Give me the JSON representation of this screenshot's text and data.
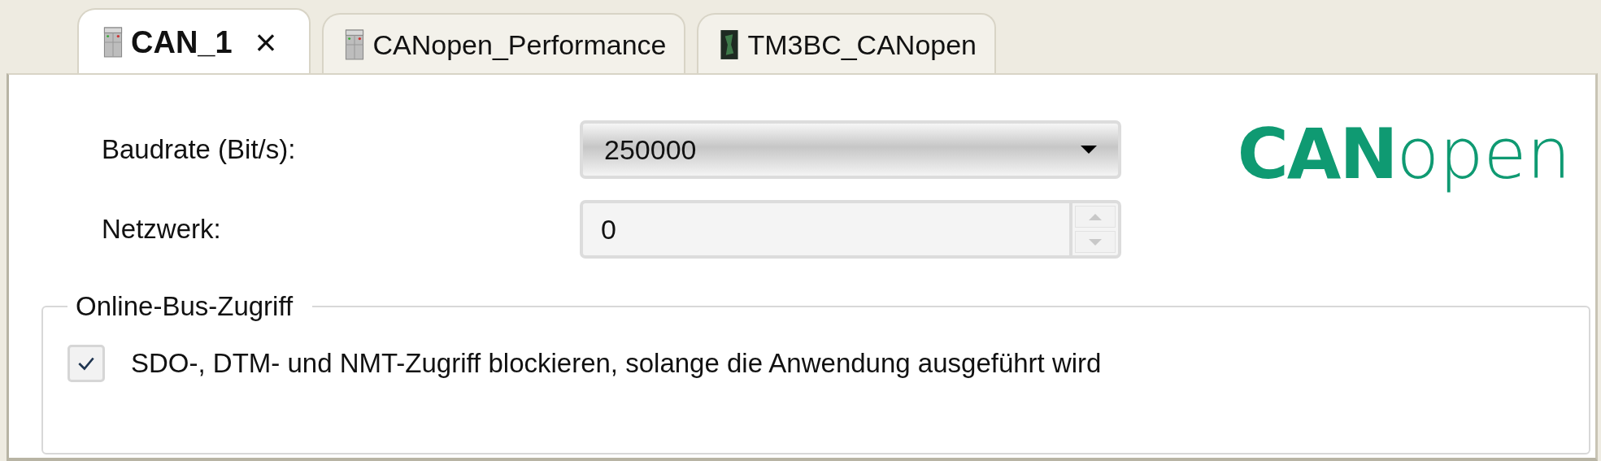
{
  "tabs": [
    {
      "label": "CAN_1",
      "selected": true,
      "kind": "controller",
      "close": "×"
    },
    {
      "label": "CANopen_Performance",
      "selected": false,
      "kind": "controller"
    },
    {
      "label": "TM3BC_CANopen",
      "selected": false,
      "kind": "module"
    }
  ],
  "baudrate": {
    "label": "Baudrate (Bit/s):",
    "value": "250000"
  },
  "network": {
    "label": "Netzwerk:",
    "value": "0"
  },
  "logo": "**CAN**open",
  "online_bus_access": {
    "title": "Online-Bus-Zugriff",
    "option": {
      "label": "SDO-, DTM- und NMT-Zugriff blockieren, solange die Anwendung ausgeführt wird",
      "checked": true
    }
  }
}
